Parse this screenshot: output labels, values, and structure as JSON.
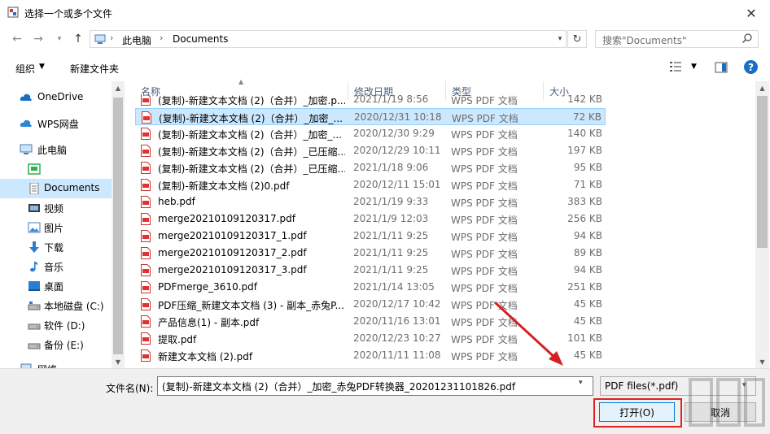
{
  "window": {
    "title": "选择一个或多个文件"
  },
  "address": {
    "breadcrumbs": [
      "此电脑",
      "Documents"
    ],
    "separator": "›",
    "search_placeholder": "搜索\"Documents\""
  },
  "toolbar": {
    "organize_label": "组织",
    "new_folder_label": "新建文件夹"
  },
  "nav": {
    "items": [
      {
        "label": "OneDrive",
        "icon": "cloud-icon"
      },
      {
        "label": "WPS网盘",
        "icon": "cloud-icon"
      },
      {
        "label": "此电脑",
        "icon": "computer-icon"
      },
      {
        "label": "",
        "icon": "wechat-folder-icon"
      },
      {
        "label": "Documents",
        "icon": "document-icon",
        "selected": true
      },
      {
        "label": "视频",
        "icon": "video-icon"
      },
      {
        "label": "图片",
        "icon": "picture-icon"
      },
      {
        "label": "下载",
        "icon": "download-icon"
      },
      {
        "label": "音乐",
        "icon": "music-icon"
      },
      {
        "label": "桌面",
        "icon": "desktop-icon"
      },
      {
        "label": "本地磁盘 (C:)",
        "icon": "drive-icon"
      },
      {
        "label": "软件 (D:)",
        "icon": "drive-icon"
      },
      {
        "label": "备份 (E:)",
        "icon": "drive-icon"
      },
      {
        "label": "网络",
        "icon": "network-icon"
      }
    ]
  },
  "columns": {
    "name": "名称",
    "date": "修改日期",
    "type": "类型",
    "size": "大小"
  },
  "files": [
    {
      "name": "(复制)-新建文本文档 (2)（合并）_加密.p...",
      "date": "2021/1/19 8:56",
      "type": "WPS PDF 文档",
      "size": "142 KB"
    },
    {
      "name": "(复制)-新建文本文档 (2)（合并）_加密_...",
      "date": "2020/12/31 10:18",
      "type": "WPS PDF 文档",
      "size": "72 KB",
      "selected": true
    },
    {
      "name": "(复制)-新建文本文档 (2)（合并）_加密_...",
      "date": "2020/12/30 9:29",
      "type": "WPS PDF 文档",
      "size": "140 KB"
    },
    {
      "name": "(复制)-新建文本文档 (2)（合并）_已压缩...",
      "date": "2020/12/29 10:11",
      "type": "WPS PDF 文档",
      "size": "197 KB"
    },
    {
      "name": "(复制)-新建文本文档 (2)（合并）_已压缩...",
      "date": "2021/1/18 9:06",
      "type": "WPS PDF 文档",
      "size": "95 KB"
    },
    {
      "name": "(复制)-新建文本文档 (2)0.pdf",
      "date": "2020/12/11 15:01",
      "type": "WPS PDF 文档",
      "size": "71 KB"
    },
    {
      "name": "heb.pdf",
      "date": "2021/1/19 9:33",
      "type": "WPS PDF 文档",
      "size": "383 KB"
    },
    {
      "name": "merge20210109120317.pdf",
      "date": "2021/1/9 12:03",
      "type": "WPS PDF 文档",
      "size": "256 KB"
    },
    {
      "name": "merge20210109120317_1.pdf",
      "date": "2021/1/11 9:25",
      "type": "WPS PDF 文档",
      "size": "94 KB"
    },
    {
      "name": "merge20210109120317_2.pdf",
      "date": "2021/1/11 9:25",
      "type": "WPS PDF 文档",
      "size": "89 KB"
    },
    {
      "name": "merge20210109120317_3.pdf",
      "date": "2021/1/11 9:25",
      "type": "WPS PDF 文档",
      "size": "94 KB"
    },
    {
      "name": "PDFmerge_3610.pdf",
      "date": "2021/1/14 13:05",
      "type": "WPS PDF 文档",
      "size": "251 KB"
    },
    {
      "name": "PDF压缩_新建文本文档 (3) - 副本_赤兔P...",
      "date": "2020/12/17 10:42",
      "type": "WPS PDF 文档",
      "size": "45 KB"
    },
    {
      "name": "产品信息(1) - 副本.pdf",
      "date": "2020/11/16 13:01",
      "type": "WPS PDF 文档",
      "size": "45 KB"
    },
    {
      "name": "提取.pdf",
      "date": "2020/12/23 10:27",
      "type": "WPS PDF 文档",
      "size": "101 KB"
    },
    {
      "name": "新建文本文档 (2).pdf",
      "date": "2020/11/11 11:08",
      "type": "WPS PDF 文档",
      "size": "45 KB"
    }
  ],
  "bottom": {
    "filename_label": "文件名(N):",
    "filename_value": "(复制)-新建文本文档 (2)（合并）_加密_赤兔PDF转换器_20201231101826.pdf",
    "filetype_value": "PDF files(*.pdf)",
    "open_label": "打开(O)",
    "cancel_label": "取消"
  },
  "colors": {
    "selection": "#cce8ff",
    "annotation": "#e02020",
    "accent": "#0078d7"
  }
}
